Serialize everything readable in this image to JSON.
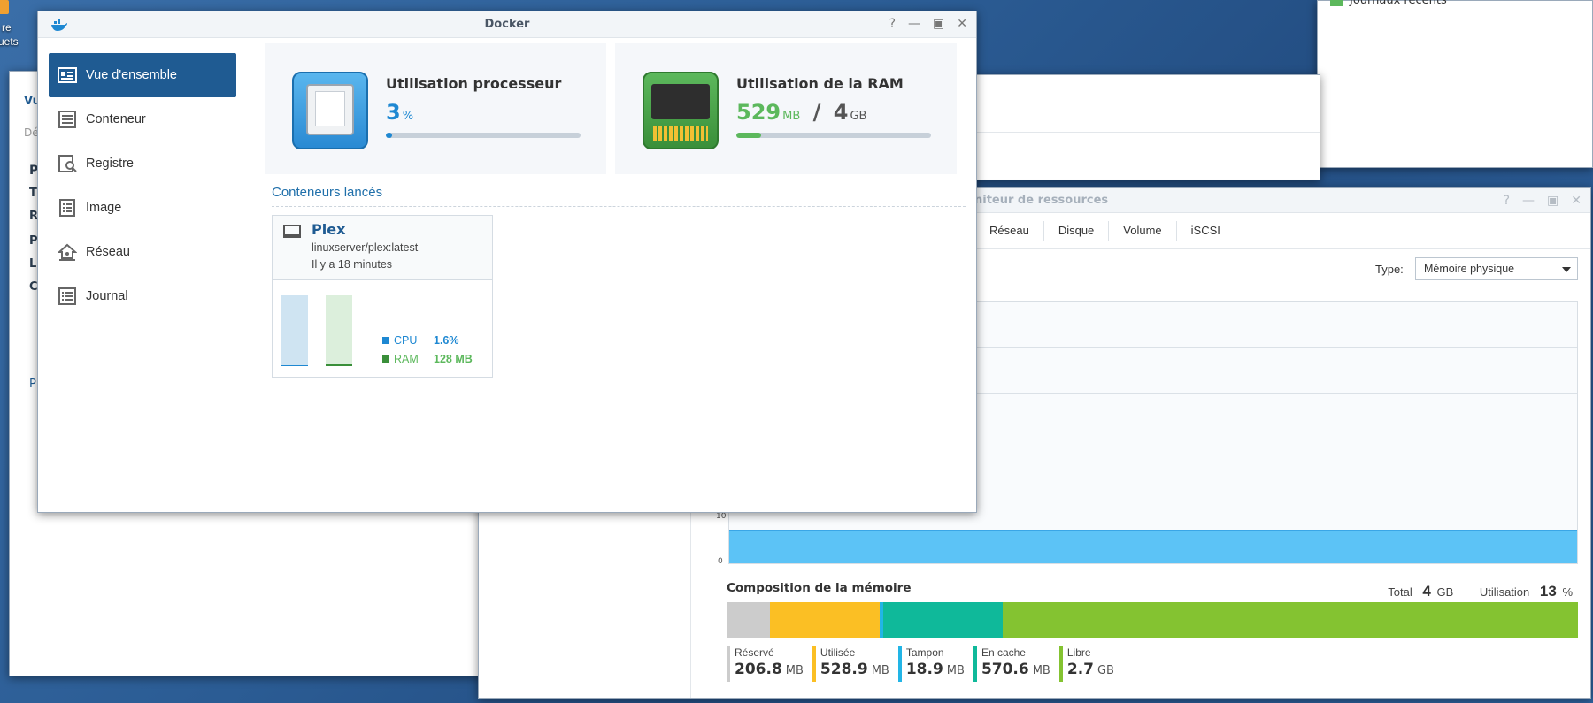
{
  "desktop": {
    "icon_label_line1": "re",
    "icon_label_line2": "uets"
  },
  "back_window": {
    "frag_vu": "Vu",
    "frag_de": "Dé",
    "frag_p1": "P",
    "frag_t": "T",
    "frag_r": "R",
    "frag_p2": "P",
    "frag_l": "L",
    "frag_c": "C",
    "frag_p3": "P"
  },
  "journal_window": {
    "title": "Journaux récents"
  },
  "resource_monitor": {
    "title": "Moniteur de ressources",
    "visible_title": "niteur de ressources",
    "tabs": [
      "Réseau",
      "Disque",
      "Volume",
      "iSCSI"
    ],
    "type_label": "Type:",
    "type_value": "Mémoire physique",
    "axis_zero": "0",
    "axis_ten": "10",
    "composition": {
      "title": "Composition de la mémoire",
      "total_label": "Total",
      "total_value": "4",
      "total_unit": "GB",
      "usage_label": "Utilisation",
      "usage_value": "13",
      "usage_unit": "%",
      "segments": [
        {
          "name": "Réservé",
          "value": "206.8",
          "unit": "MB",
          "mb": 206.8,
          "color": "#cccccc"
        },
        {
          "name": "Utilisée",
          "value": "528.9",
          "unit": "MB",
          "mb": 528.9,
          "color": "#fbbf24"
        },
        {
          "name": "Tampon",
          "value": "18.9",
          "unit": "MB",
          "mb": 18.9,
          "color": "#22b5e6"
        },
        {
          "name": "En cache",
          "value": "570.6",
          "unit": "MB",
          "mb": 570.6,
          "color": "#0fb99a"
        },
        {
          "name": "Libre",
          "value": "2.7",
          "unit": "GB",
          "mb": 2764.8,
          "color": "#84c331"
        }
      ]
    }
  },
  "docker": {
    "title": "Docker",
    "controls": {
      "help": "?",
      "minimize": "—",
      "maximize": "▣",
      "close": "✕"
    },
    "nav": [
      {
        "label": "Vue d'ensemble",
        "icon": "overview-icon",
        "active": true
      },
      {
        "label": "Conteneur",
        "icon": "container-list-icon",
        "active": false
      },
      {
        "label": "Registre",
        "icon": "registry-search-icon",
        "active": false
      },
      {
        "label": "Image",
        "icon": "image-icon",
        "active": false
      },
      {
        "label": "Réseau",
        "icon": "network-house-icon",
        "active": false
      },
      {
        "label": "Journal",
        "icon": "log-icon",
        "active": false
      }
    ],
    "cpu": {
      "title": "Utilisation processeur",
      "value": "3",
      "unit": "%",
      "fraction": 0.03,
      "color": "#1e88d2"
    },
    "ram": {
      "title": "Utilisation de la RAM",
      "used_value": "529",
      "used_unit": "MB",
      "separator": "/",
      "total_value": "4",
      "total_unit": "GB",
      "fraction": 0.129,
      "color": "#5cb85c"
    },
    "running_title": "Conteneurs lancés",
    "containers": [
      {
        "name": "Plex",
        "image": "linuxserver/plex:latest",
        "uptime": "Il y a 18 minutes",
        "cpu_label": "CPU",
        "cpu_value": "1.6%",
        "cpu_fraction": 0.016,
        "ram_label": "RAM",
        "ram_value": "128 MB",
        "ram_fraction": 0.031
      }
    ]
  }
}
